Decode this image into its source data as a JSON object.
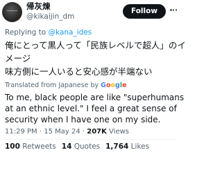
{
  "author": {
    "display_name": "帰灰煉",
    "username": "@kikaijin_dm"
  },
  "follow_label": "Follow",
  "reply_context": {
    "prefix": "Replying to ",
    "mention": "@kana_ides"
  },
  "original_text": [
    "俺にとって黒人って「民族レベルで超人」のイ",
    "メージ",
    "味方側に一人いると安心感が半端ない"
  ],
  "translated_from": "Translated from Japanese by",
  "translator_brand": [
    "G",
    "o",
    "o",
    "g",
    "l",
    "e"
  ],
  "translation_text": [
    "To me, black people are like \"superhumans",
    "at an ethnic level.\" I feel a great sense of",
    "security when I have one on my side."
  ],
  "meta": {
    "time": "11:29 PM",
    "separator": " · ",
    "date": "15 May 24",
    "views_count": "207K",
    "views_label": " Views"
  },
  "stats": {
    "retweets_count": "100",
    "retweets_label": " Retweets",
    "quotes_count": "14",
    "quotes_label": " Quotes",
    "likes_count": "1,764",
    "likes_label": " Likes"
  },
  "colors": {
    "accent": "#1d9bf0",
    "text": "#0f1419",
    "secondary": "#536471",
    "follow_bg": "#0f1419"
  }
}
